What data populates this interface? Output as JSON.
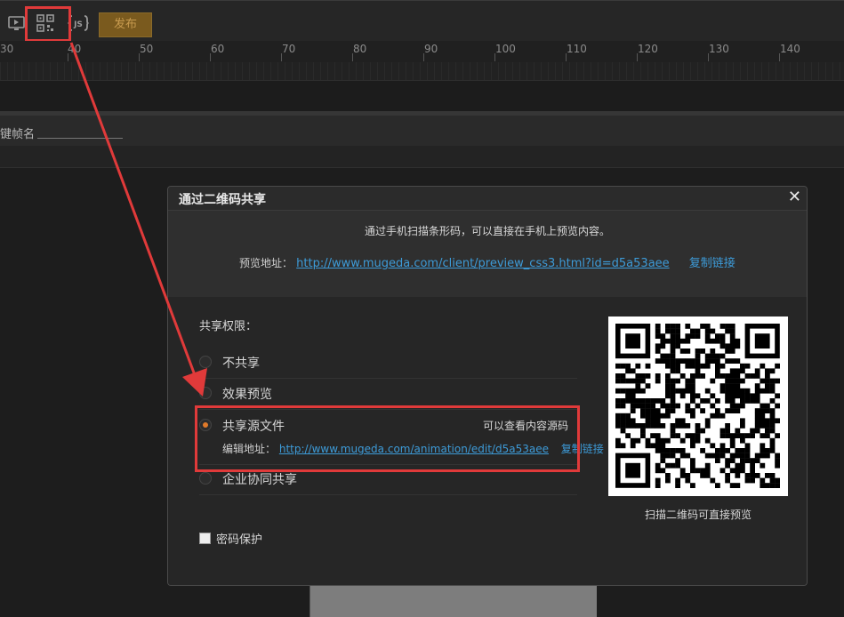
{
  "toolbar": {
    "icons": [
      "preview-icon",
      "qrcode-icon",
      "js-icon"
    ],
    "js_label": "JS",
    "publish_label": "发布"
  },
  "ruler": {
    "ticks": [
      "30",
      "40",
      "50",
      "60",
      "70",
      "80",
      "90",
      "100",
      "110",
      "120",
      "130",
      "140"
    ]
  },
  "keyframe": {
    "name_label": "键帧名"
  },
  "dialog": {
    "title": "通过二维码共享",
    "close_icon": "close-icon",
    "instruction": "通过手机扫描条形码，可以直接在手机上预览内容。",
    "preview_label": "预览地址：",
    "preview_url": "http://www.mugeda.com/client/preview_css3.html?id=d5a53aee",
    "copy_link": "复制链接",
    "share_permission_label": "共享权限：",
    "options": [
      {
        "label": "不共享",
        "selected": false
      },
      {
        "label": "效果预览",
        "selected": false
      },
      {
        "label": "共享源文件",
        "selected": true,
        "note": "可以查看内容源码"
      },
      {
        "label": "企业协同共享",
        "selected": false
      }
    ],
    "edit_label": "编辑地址：",
    "edit_url": "http://www.mugeda.com/animation/edit/d5a53aee",
    "edit_copy_link": "复制链接",
    "password_label": "密码保护",
    "password_checked": false,
    "qr_caption": "扫描二维码可直接预览"
  },
  "colors": {
    "accent": "#e07a2a",
    "link": "#3d9bd8",
    "annotation": "#e03a3a",
    "publish_bg": "#7a5a1e"
  }
}
